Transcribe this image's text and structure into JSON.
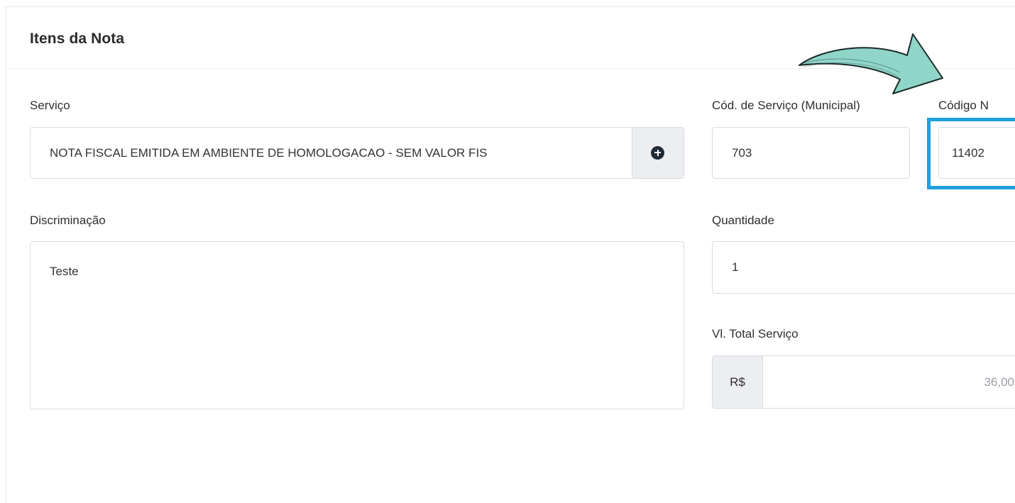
{
  "card": {
    "title": "Itens da Nota"
  },
  "servico": {
    "label": "Serviço",
    "value": "NOTA FISCAL EMITIDA EM AMBIENTE DE HOMOLOGACAO - SEM VALOR FIS",
    "add_icon": "plus-circle-icon"
  },
  "cod_servico": {
    "label": "Cód. de Serviço (Municipal)",
    "value": "703"
  },
  "codigo_n": {
    "label": "Código N",
    "value": "11402"
  },
  "discriminacao": {
    "label": "Discriminação",
    "value": "Teste"
  },
  "quantidade": {
    "label": "Quantidade",
    "value": "1"
  },
  "vl_total": {
    "label": "Vl. Total Serviço",
    "currency": "R$",
    "value": "36,00"
  },
  "colors": {
    "highlight": "#1ea0e0",
    "arrow_fill": "#8fd6c8"
  }
}
